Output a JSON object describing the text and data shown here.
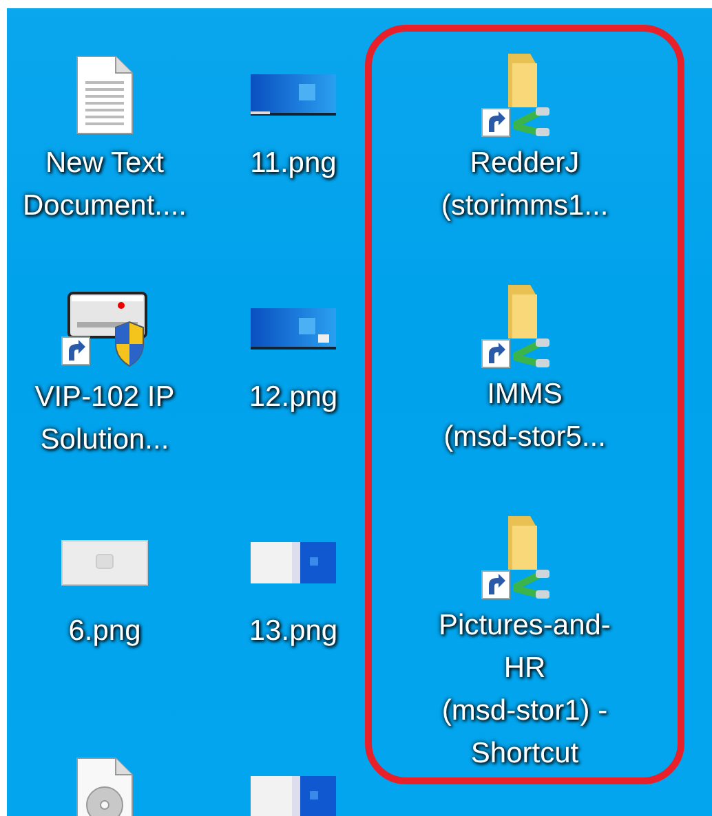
{
  "columns": [
    {
      "highlighted": false,
      "items": [
        {
          "kind": "text-document",
          "label": [
            "New Text",
            "Document...."
          ]
        },
        {
          "kind": "device-shortcut",
          "label": [
            "VIP-102 IP",
            "Solution..."
          ]
        },
        {
          "kind": "image-light",
          "label": [
            "6.png"
          ]
        },
        {
          "kind": "disc-file"
        }
      ]
    },
    {
      "highlighted": false,
      "items": [
        {
          "kind": "image-desktop",
          "label": [
            "11.png"
          ]
        },
        {
          "kind": "image-desktop-small",
          "label": [
            "12.png"
          ]
        },
        {
          "kind": "image-split",
          "label": [
            "13.png"
          ]
        },
        {
          "kind": "image-split"
        }
      ]
    },
    {
      "highlighted": true,
      "items": [
        {
          "kind": "network-folder-shortcut",
          "label": [
            "RedderJ",
            "(storimms1..."
          ]
        },
        {
          "kind": "network-folder-shortcut",
          "label": [
            "IMMS",
            "(msd-stor5..."
          ]
        },
        {
          "kind": "network-folder-shortcut",
          "label": [
            "Pictures-and-",
            "HR",
            "(msd-stor1) -",
            "Shortcut"
          ]
        }
      ]
    }
  ]
}
